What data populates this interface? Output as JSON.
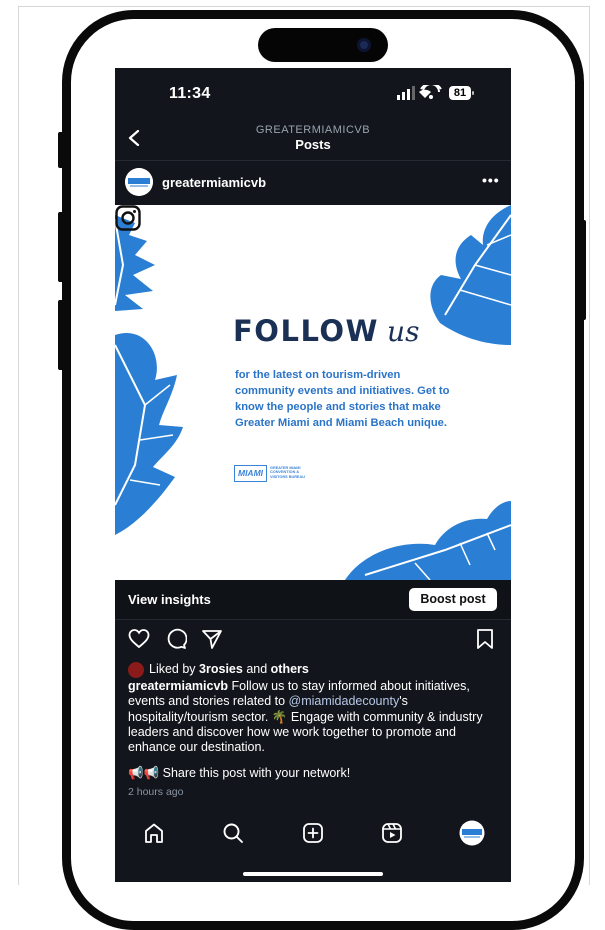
{
  "status_bar": {
    "time": "11:34",
    "battery": "81"
  },
  "nav": {
    "subtitle": "GREATERMIAMICVB",
    "title": "Posts"
  },
  "post_header": {
    "username": "greatermiamicvb",
    "more": "•••"
  },
  "post_image": {
    "heading_main": "FOLLOW",
    "heading_script": "us",
    "body_lines": [
      "for the latest on tourism-driven",
      "community events and initiatives. Get to",
      "know the people and stories that make",
      "Greater Miami and Miami Beach unique."
    ],
    "logo_text": "MIAMI",
    "logo_subtext": [
      "GREATER MIAMI",
      "CONVENTION &",
      "VISITORS BUREAU"
    ],
    "brand_color": "#2a7fd4"
  },
  "insights": {
    "label": "View insights",
    "boost_label": "Boost post"
  },
  "likes": {
    "prefix": "Liked by",
    "user": "3rosies",
    "joiner": "and",
    "others": "others"
  },
  "caption": {
    "username": "greatermiamicvb",
    "text_1": "Follow us to stay informed about initiatives, events and stories related to",
    "mention": "@miamidadecounty",
    "text_2": "'s hospitality/tourism sector. 🌴 Engage with community & industry leaders and discover how we work together to promote and enhance our destination."
  },
  "share": {
    "text": "📢📢 Share this post with your network!"
  },
  "timestamp": "2 hours ago",
  "tabbar": {
    "icons": [
      "home-icon",
      "search-icon",
      "create-icon",
      "reels-icon",
      "profile-avatar"
    ]
  },
  "colors": {
    "screen_bg": "#12161c",
    "accent_blue": "#2a7fd4",
    "navy_text": "#1a3155"
  }
}
